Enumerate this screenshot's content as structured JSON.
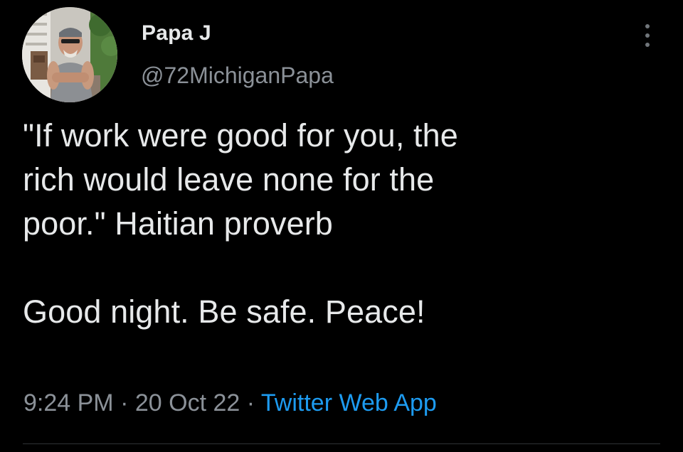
{
  "author": {
    "display_name": "Papa J",
    "handle": "@72MichiganPapa"
  },
  "tweet": {
    "text_lines": [
      "\"If work were good for you, the",
      "rich would leave none for the",
      "poor.\" Haitian proverb",
      "Good night. Be safe. Peace!"
    ]
  },
  "meta": {
    "time": "9:24 PM",
    "separator": "·",
    "date": "20 Oct 22",
    "source": "Twitter Web App"
  },
  "icons": {
    "more": "more-horizontal-icon"
  },
  "colors": {
    "background": "#000000",
    "text": "#e7e9ea",
    "secondary": "#8b9198",
    "link": "#1d9bf0"
  }
}
